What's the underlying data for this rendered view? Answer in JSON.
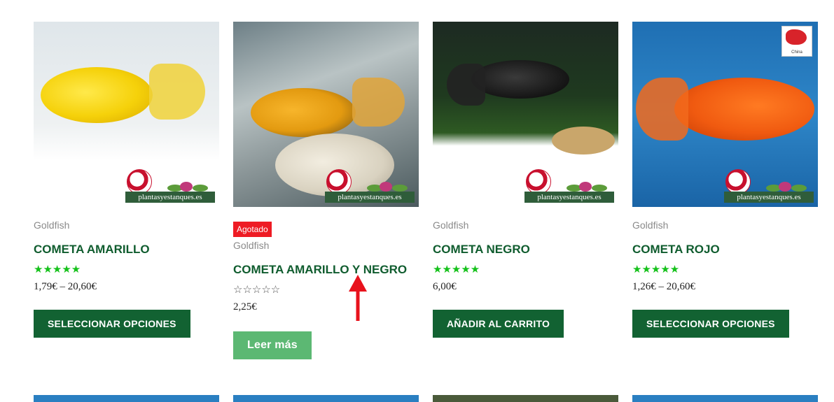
{
  "products": [
    {
      "category": "Goldfish",
      "name": "COMETA AMARILLO",
      "rating_stars": 5,
      "price": "1,79€ – 20,60€",
      "button_label": "SELECCIONAR OPCIONES",
      "watermark": "plantasyestanques.es"
    },
    {
      "badge": "Agotado",
      "category": "Goldfish",
      "name": "COMETA AMARILLO Y NEGRO",
      "rating_stars": 0,
      "price": "2,25€",
      "button_label": "Leer más",
      "watermark": "plantasyestanques.es"
    },
    {
      "category": "Goldfish",
      "name": "COMETA NEGRO",
      "rating_stars": 5,
      "price": "6,00€",
      "button_label": "AÑADIR AL CARRITO",
      "watermark": "plantasyestanques.es"
    },
    {
      "category": "Goldfish",
      "name": "COMETA ROJO",
      "rating_stars": 5,
      "price": "1,26€ – 20,60€",
      "button_label": "SELECCIONAR OPCIONES",
      "watermark": "plantasyestanques.es",
      "flag_label": "China"
    }
  ],
  "stars": {
    "full": "★★★★★",
    "empty": "☆☆☆☆☆"
  },
  "colors": {
    "title_green": "#0f5c2e",
    "button_green": "#126232",
    "button_light": "#5cb873",
    "star_green": "#14c11a",
    "badge_red": "#ee1b24",
    "arrow_red": "#e8121c"
  }
}
